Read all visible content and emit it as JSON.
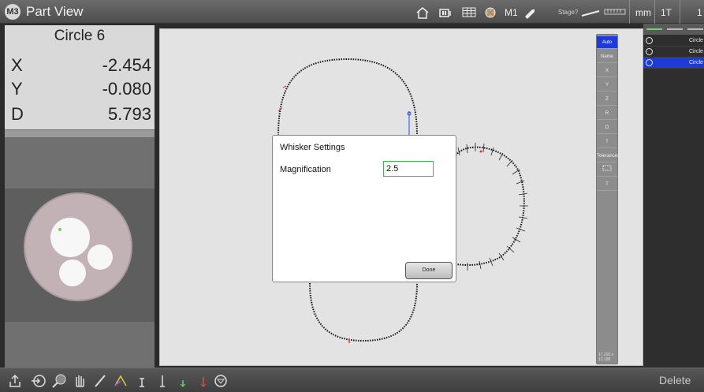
{
  "topbar": {
    "app_logo": "M3",
    "title": "Part View",
    "icons": [
      "home-icon",
      "video-icon",
      "grid-icon",
      "light-icon"
    ],
    "program": "M1",
    "stage_label": "Stage?",
    "units": "mm",
    "mode": "1T",
    "extra": "1"
  },
  "dro": {
    "feature_name": "Circle 6",
    "rows": [
      {
        "axis": "X",
        "value": "-2.454"
      },
      {
        "axis": "Y",
        "value": "-0.080"
      },
      {
        "axis": "D",
        "value": "5.793"
      }
    ]
  },
  "view_toolbar": {
    "buttons": [
      "Auto",
      "Name",
      "X",
      "Y",
      "Z",
      "R",
      "D",
      "f",
      "Tolerances",
      "",
      "T"
    ],
    "footer": "17.220 x 12.188"
  },
  "dialog": {
    "title": "Whisker Settings",
    "magnification_label": "Magnification",
    "magnification_value": "2.5",
    "done_label": "Done"
  },
  "feature_list": {
    "items": [
      {
        "label": "Circle",
        "selected": false
      },
      {
        "label": "Circle",
        "selected": false
      },
      {
        "label": "Circle",
        "selected": true
      }
    ]
  },
  "bottombar": {
    "delete_label": "Delete"
  },
  "colors": {
    "accent_blue": "#1c3bd8",
    "input_border": "#3fb44a",
    "view_bg": "#e3e3e3"
  }
}
